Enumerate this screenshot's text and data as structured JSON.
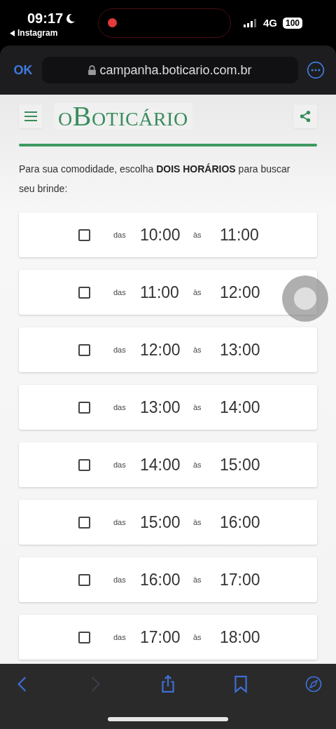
{
  "status_bar": {
    "time": "09:17",
    "back_app": "Instagram",
    "network": "4G",
    "battery": "100",
    "recording": true
  },
  "browser": {
    "done": "OK",
    "url": "campanha.boticario.com.br"
  },
  "site": {
    "logo": "oBoticário"
  },
  "intro": "Para sua comodidade, escolha **DOIS HORÁRIOS** para buscar seu brinde:",
  "slots": [
    {
      "from_label": "das",
      "start": "10:00",
      "to_label": "às",
      "end": "11:00",
      "checked": false
    },
    {
      "from_label": "das",
      "start": "11:00",
      "to_label": "às",
      "end": "12:00",
      "checked": false
    },
    {
      "from_label": "das",
      "start": "12:00",
      "to_label": "às",
      "end": "13:00",
      "checked": false
    },
    {
      "from_label": "das",
      "start": "13:00",
      "to_label": "às",
      "end": "14:00",
      "checked": false
    },
    {
      "from_label": "das",
      "start": "14:00",
      "to_label": "às",
      "end": "15:00",
      "checked": false
    },
    {
      "from_label": "das",
      "start": "15:00",
      "to_label": "às",
      "end": "16:00",
      "checked": false
    },
    {
      "from_label": "das",
      "start": "16:00",
      "to_label": "às",
      "end": "17:00",
      "checked": false
    },
    {
      "from_label": "das",
      "start": "17:00",
      "to_label": "às",
      "end": "18:00",
      "checked": false
    }
  ],
  "toolbar": {
    "forward_disabled": true
  }
}
